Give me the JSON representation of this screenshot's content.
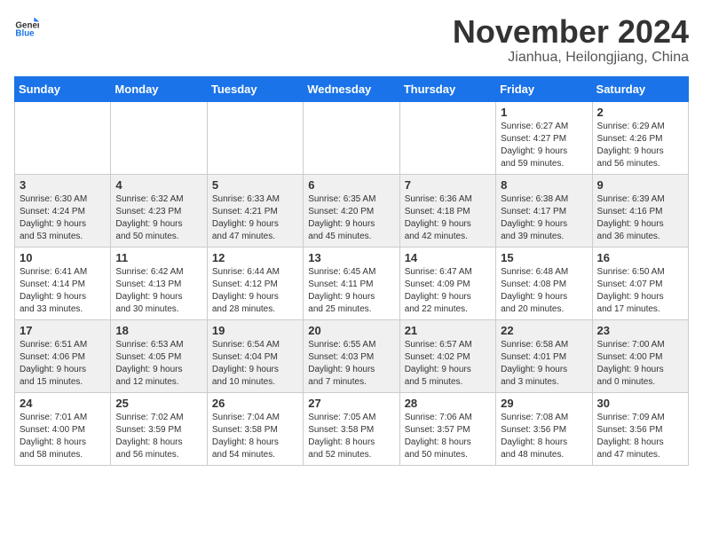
{
  "header": {
    "logo_general": "General",
    "logo_blue": "Blue",
    "month": "November 2024",
    "location": "Jianhua, Heilongjiang, China"
  },
  "weekdays": [
    "Sunday",
    "Monday",
    "Tuesday",
    "Wednesday",
    "Thursday",
    "Friday",
    "Saturday"
  ],
  "weeks": [
    [
      {
        "day": "",
        "info": ""
      },
      {
        "day": "",
        "info": ""
      },
      {
        "day": "",
        "info": ""
      },
      {
        "day": "",
        "info": ""
      },
      {
        "day": "",
        "info": ""
      },
      {
        "day": "1",
        "info": "Sunrise: 6:27 AM\nSunset: 4:27 PM\nDaylight: 9 hours\nand 59 minutes."
      },
      {
        "day": "2",
        "info": "Sunrise: 6:29 AM\nSunset: 4:26 PM\nDaylight: 9 hours\nand 56 minutes."
      }
    ],
    [
      {
        "day": "3",
        "info": "Sunrise: 6:30 AM\nSunset: 4:24 PM\nDaylight: 9 hours\nand 53 minutes."
      },
      {
        "day": "4",
        "info": "Sunrise: 6:32 AM\nSunset: 4:23 PM\nDaylight: 9 hours\nand 50 minutes."
      },
      {
        "day": "5",
        "info": "Sunrise: 6:33 AM\nSunset: 4:21 PM\nDaylight: 9 hours\nand 47 minutes."
      },
      {
        "day": "6",
        "info": "Sunrise: 6:35 AM\nSunset: 4:20 PM\nDaylight: 9 hours\nand 45 minutes."
      },
      {
        "day": "7",
        "info": "Sunrise: 6:36 AM\nSunset: 4:18 PM\nDaylight: 9 hours\nand 42 minutes."
      },
      {
        "day": "8",
        "info": "Sunrise: 6:38 AM\nSunset: 4:17 PM\nDaylight: 9 hours\nand 39 minutes."
      },
      {
        "day": "9",
        "info": "Sunrise: 6:39 AM\nSunset: 4:16 PM\nDaylight: 9 hours\nand 36 minutes."
      }
    ],
    [
      {
        "day": "10",
        "info": "Sunrise: 6:41 AM\nSunset: 4:14 PM\nDaylight: 9 hours\nand 33 minutes."
      },
      {
        "day": "11",
        "info": "Sunrise: 6:42 AM\nSunset: 4:13 PM\nDaylight: 9 hours\nand 30 minutes."
      },
      {
        "day": "12",
        "info": "Sunrise: 6:44 AM\nSunset: 4:12 PM\nDaylight: 9 hours\nand 28 minutes."
      },
      {
        "day": "13",
        "info": "Sunrise: 6:45 AM\nSunset: 4:11 PM\nDaylight: 9 hours\nand 25 minutes."
      },
      {
        "day": "14",
        "info": "Sunrise: 6:47 AM\nSunset: 4:09 PM\nDaylight: 9 hours\nand 22 minutes."
      },
      {
        "day": "15",
        "info": "Sunrise: 6:48 AM\nSunset: 4:08 PM\nDaylight: 9 hours\nand 20 minutes."
      },
      {
        "day": "16",
        "info": "Sunrise: 6:50 AM\nSunset: 4:07 PM\nDaylight: 9 hours\nand 17 minutes."
      }
    ],
    [
      {
        "day": "17",
        "info": "Sunrise: 6:51 AM\nSunset: 4:06 PM\nDaylight: 9 hours\nand 15 minutes."
      },
      {
        "day": "18",
        "info": "Sunrise: 6:53 AM\nSunset: 4:05 PM\nDaylight: 9 hours\nand 12 minutes."
      },
      {
        "day": "19",
        "info": "Sunrise: 6:54 AM\nSunset: 4:04 PM\nDaylight: 9 hours\nand 10 minutes."
      },
      {
        "day": "20",
        "info": "Sunrise: 6:55 AM\nSunset: 4:03 PM\nDaylight: 9 hours\nand 7 minutes."
      },
      {
        "day": "21",
        "info": "Sunrise: 6:57 AM\nSunset: 4:02 PM\nDaylight: 9 hours\nand 5 minutes."
      },
      {
        "day": "22",
        "info": "Sunrise: 6:58 AM\nSunset: 4:01 PM\nDaylight: 9 hours\nand 3 minutes."
      },
      {
        "day": "23",
        "info": "Sunrise: 7:00 AM\nSunset: 4:00 PM\nDaylight: 9 hours\nand 0 minutes."
      }
    ],
    [
      {
        "day": "24",
        "info": "Sunrise: 7:01 AM\nSunset: 4:00 PM\nDaylight: 8 hours\nand 58 minutes."
      },
      {
        "day": "25",
        "info": "Sunrise: 7:02 AM\nSunset: 3:59 PM\nDaylight: 8 hours\nand 56 minutes."
      },
      {
        "day": "26",
        "info": "Sunrise: 7:04 AM\nSunset: 3:58 PM\nDaylight: 8 hours\nand 54 minutes."
      },
      {
        "day": "27",
        "info": "Sunrise: 7:05 AM\nSunset: 3:58 PM\nDaylight: 8 hours\nand 52 minutes."
      },
      {
        "day": "28",
        "info": "Sunrise: 7:06 AM\nSunset: 3:57 PM\nDaylight: 8 hours\nand 50 minutes."
      },
      {
        "day": "29",
        "info": "Sunrise: 7:08 AM\nSunset: 3:56 PM\nDaylight: 8 hours\nand 48 minutes."
      },
      {
        "day": "30",
        "info": "Sunrise: 7:09 AM\nSunset: 3:56 PM\nDaylight: 8 hours\nand 47 minutes."
      }
    ]
  ]
}
